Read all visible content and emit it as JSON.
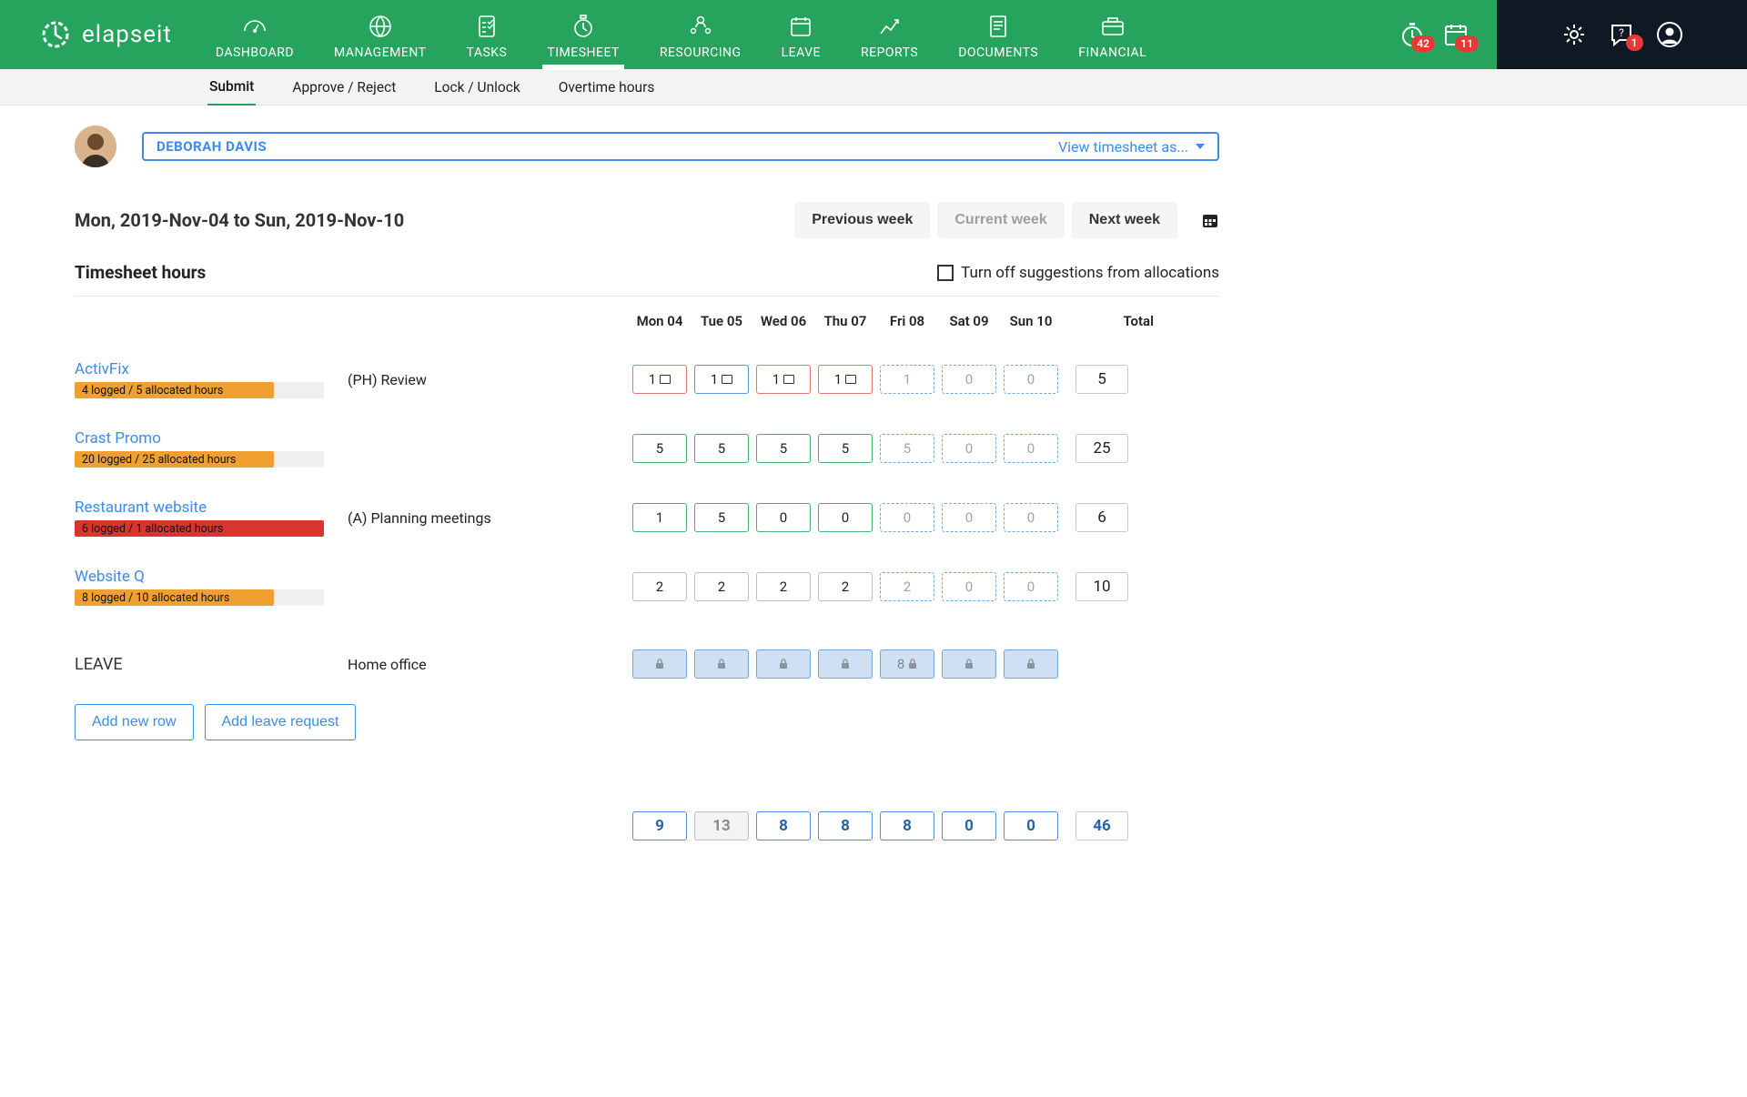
{
  "brand": {
    "name": "elapseit"
  },
  "nav": [
    {
      "label": "DASHBOARD",
      "active": false
    },
    {
      "label": "MANAGEMENT",
      "active": false
    },
    {
      "label": "TASKS",
      "active": false
    },
    {
      "label": "TIMESHEET",
      "active": true
    },
    {
      "label": "RESOURCING",
      "active": false
    },
    {
      "label": "LEAVE",
      "active": false
    },
    {
      "label": "REPORTS",
      "active": false
    },
    {
      "label": "DOCUMENTS",
      "active": false
    },
    {
      "label": "FINANCIAL",
      "active": false
    }
  ],
  "notif": {
    "timer_badge": "42",
    "calendar_badge": "11",
    "chat_badge": "1"
  },
  "subtabs": [
    {
      "label": "Submit",
      "active": true
    },
    {
      "label": "Approve / Reject",
      "active": false
    },
    {
      "label": "Lock / Unlock",
      "active": false
    },
    {
      "label": "Overtime hours",
      "active": false
    }
  ],
  "user": {
    "name": "DEBORAH DAVIS",
    "view_as": "View timesheet as..."
  },
  "week": {
    "range": "Mon, 2019-Nov-04 to Sun, 2019-Nov-10",
    "prev": "Previous week",
    "curr": "Current week",
    "next": "Next week"
  },
  "section": {
    "title": "Timesheet hours",
    "toggle": "Turn off suggestions from allocations"
  },
  "days": [
    "Mon 04",
    "Tue 05",
    "Wed 06",
    "Thu 07",
    "Fri 08",
    "Sat 09",
    "Sun 10"
  ],
  "total_label": "Total",
  "rows": [
    {
      "project": "ActivFix",
      "alloc_text": "4 logged / 5 allocated hours",
      "alloc_pct": 80,
      "alloc_color": "orange",
      "phase": "(PH) Review",
      "cells": [
        {
          "v": "1",
          "style": "red-b",
          "note": true
        },
        {
          "v": "1",
          "style": "blue-b",
          "note": true
        },
        {
          "v": "1",
          "style": "red-b",
          "note": true
        },
        {
          "v": "1",
          "style": "red-b",
          "note": true
        },
        {
          "v": "1",
          "style": "dashed"
        },
        {
          "v": "0",
          "style": "dashed"
        },
        {
          "v": "0",
          "style": "dashed"
        }
      ],
      "total": "5"
    },
    {
      "project": "Crast Promo",
      "alloc_text": "20 logged / 25 allocated hours",
      "alloc_pct": 80,
      "alloc_color": "orange",
      "phase": "",
      "cells": [
        {
          "v": "5",
          "style": "green-b"
        },
        {
          "v": "5",
          "style": "green-b"
        },
        {
          "v": "5",
          "style": "green-b"
        },
        {
          "v": "5",
          "style": "green-b"
        },
        {
          "v": "5",
          "style": "dashed"
        },
        {
          "v": "0",
          "style": "dashed"
        },
        {
          "v": "0",
          "style": "dashed"
        }
      ],
      "total": "25"
    },
    {
      "project": "Restaurant website",
      "alloc_text": "6 logged / 1 allocated hours",
      "alloc_pct": 100,
      "alloc_color": "red",
      "phase": "(A) Planning meetings",
      "cells": [
        {
          "v": "1",
          "style": "green-b"
        },
        {
          "v": "5",
          "style": "green-b"
        },
        {
          "v": "0",
          "style": "green-b"
        },
        {
          "v": "0",
          "style": "green-b"
        },
        {
          "v": "0",
          "style": "dashed"
        },
        {
          "v": "0",
          "style": "dashed"
        },
        {
          "v": "0",
          "style": "dashed"
        }
      ],
      "total": "6"
    },
    {
      "project": "Website Q",
      "alloc_text": "8 logged / 10 allocated hours",
      "alloc_pct": 80,
      "alloc_color": "orange",
      "phase": "",
      "cells": [
        {
          "v": "2",
          "style": "gray-b"
        },
        {
          "v": "2",
          "style": "gray-b"
        },
        {
          "v": "2",
          "style": "gray-b"
        },
        {
          "v": "2",
          "style": "gray-b"
        },
        {
          "v": "2",
          "style": "dashed"
        },
        {
          "v": "0",
          "style": "dashed"
        },
        {
          "v": "0",
          "style": "dashed"
        }
      ],
      "total": "10"
    }
  ],
  "leave": {
    "label": "LEAVE",
    "phase": "Home office",
    "cells": [
      {
        "v": "",
        "lock": true
      },
      {
        "v": "",
        "lock": true
      },
      {
        "v": "",
        "lock": true
      },
      {
        "v": "",
        "lock": true
      },
      {
        "v": "8",
        "lock": true
      },
      {
        "v": "",
        "lock": true
      },
      {
        "v": "",
        "lock": true
      }
    ]
  },
  "buttons": {
    "add_row": "Add new row",
    "add_leave": "Add leave request"
  },
  "totals": {
    "days": [
      {
        "v": "9",
        "style": "sum-blue"
      },
      {
        "v": "13",
        "style": "sum-dim"
      },
      {
        "v": "8",
        "style": "sum-blue"
      },
      {
        "v": "8",
        "style": "sum-blue"
      },
      {
        "v": "8",
        "style": "sum-blue"
      },
      {
        "v": "0",
        "style": "sum-blue"
      },
      {
        "v": "0",
        "style": "sum-blue"
      }
    ],
    "grand": "46"
  }
}
